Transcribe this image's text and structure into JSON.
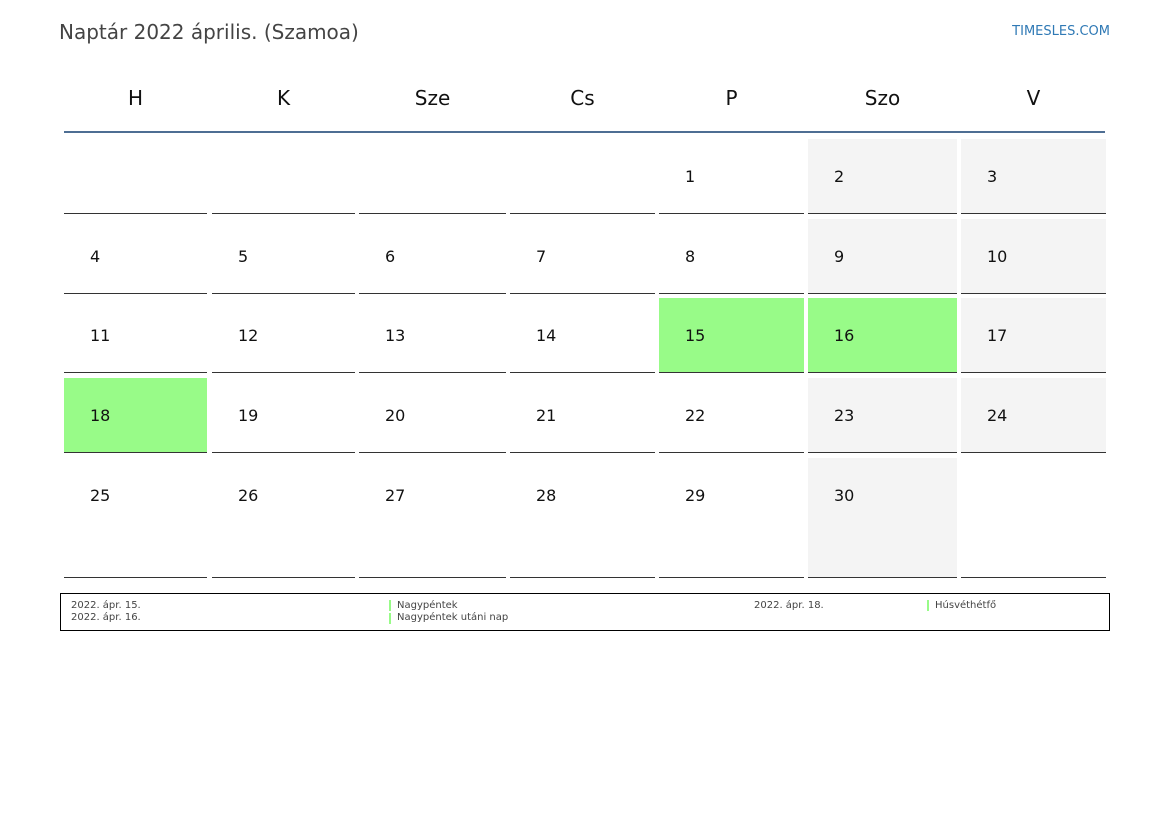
{
  "header": {
    "title": "Naptár 2022 április. (Szamoa)",
    "site": "TIMESLES.COM"
  },
  "weekdays": [
    "H",
    "K",
    "Sze",
    "Cs",
    "P",
    "Szo",
    "V"
  ],
  "calendar": {
    "weeks": [
      [
        {
          "day": "",
          "type": "normal"
        },
        {
          "day": "",
          "type": "normal"
        },
        {
          "day": "",
          "type": "normal"
        },
        {
          "day": "",
          "type": "normal"
        },
        {
          "day": "1",
          "type": "normal"
        },
        {
          "day": "2",
          "type": "weekend"
        },
        {
          "day": "3",
          "type": "weekend"
        }
      ],
      [
        {
          "day": "4",
          "type": "normal"
        },
        {
          "day": "5",
          "type": "normal"
        },
        {
          "day": "6",
          "type": "normal"
        },
        {
          "day": "7",
          "type": "normal"
        },
        {
          "day": "8",
          "type": "normal"
        },
        {
          "day": "9",
          "type": "weekend"
        },
        {
          "day": "10",
          "type": "weekend"
        }
      ],
      [
        {
          "day": "11",
          "type": "normal"
        },
        {
          "day": "12",
          "type": "normal"
        },
        {
          "day": "13",
          "type": "normal"
        },
        {
          "day": "14",
          "type": "normal"
        },
        {
          "day": "15",
          "type": "holiday"
        },
        {
          "day": "16",
          "type": "holiday"
        },
        {
          "day": "17",
          "type": "weekend"
        }
      ],
      [
        {
          "day": "18",
          "type": "holiday"
        },
        {
          "day": "19",
          "type": "normal"
        },
        {
          "day": "20",
          "type": "normal"
        },
        {
          "day": "21",
          "type": "normal"
        },
        {
          "day": "22",
          "type": "normal"
        },
        {
          "day": "23",
          "type": "weekend"
        },
        {
          "day": "24",
          "type": "weekend"
        }
      ],
      [
        {
          "day": "25",
          "type": "normal"
        },
        {
          "day": "26",
          "type": "normal"
        },
        {
          "day": "27",
          "type": "normal"
        },
        {
          "day": "28",
          "type": "normal"
        },
        {
          "day": "29",
          "type": "normal"
        },
        {
          "day": "30",
          "type": "weekend"
        },
        {
          "day": "",
          "type": "normal"
        }
      ]
    ]
  },
  "legend": {
    "holidays": [
      {
        "date": "2022. ápr. 15.",
        "name": "Nagypéntek"
      },
      {
        "date": "2022. ápr. 16.",
        "name": "Nagypéntek utáni nap"
      },
      {
        "date": "2022. ápr. 18.",
        "name": "Húsvéthétfő"
      }
    ]
  },
  "colors": {
    "holiday": "#98fb88",
    "weekend": "#f4f4f4",
    "rule": "#4e6e93",
    "link": "#2f79b5"
  }
}
